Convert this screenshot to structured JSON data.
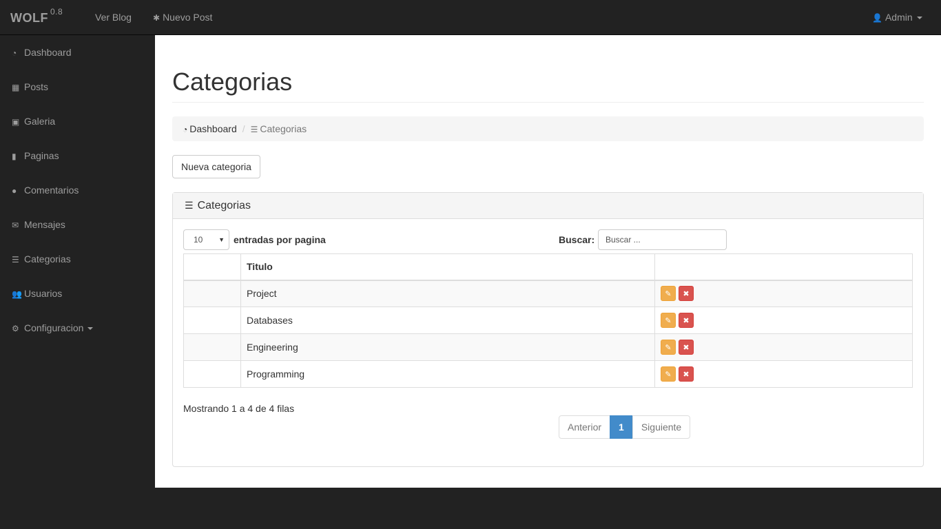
{
  "navbar": {
    "brand": "WOLF",
    "version": "0.8",
    "links": [
      {
        "label": "Ver Blog",
        "icon": ""
      },
      {
        "label": "Nuevo Post",
        "icon": "asterisk-icon"
      }
    ],
    "user": {
      "label": "Admin",
      "icon": "user-icon"
    }
  },
  "sidebar": {
    "items": [
      {
        "label": "Dashboard",
        "icon": "dashboard-icon"
      },
      {
        "label": "Posts",
        "icon": "grid-icon"
      },
      {
        "label": "Galeria",
        "icon": "image-icon"
      },
      {
        "label": "Paginas",
        "icon": "file-icon"
      },
      {
        "label": "Comentarios",
        "icon": "comments-icon"
      },
      {
        "label": "Mensajes",
        "icon": "envelope-icon"
      },
      {
        "label": "Categorias",
        "icon": "list-icon"
      },
      {
        "label": "Usuarios",
        "icon": "users-icon"
      },
      {
        "label": "Configuracion",
        "icon": "cogs-icon"
      }
    ]
  },
  "page": {
    "title": "Categorias",
    "breadcrumb": [
      {
        "label": "Dashboard",
        "icon": "dashboard-icon"
      },
      {
        "label": "Categorias",
        "icon": "list-icon"
      }
    ],
    "new_button": "Nueva categoria"
  },
  "panel": {
    "title": "Categorias",
    "icon": "list-icon",
    "length_value": "10",
    "length_label": "entradas por pagina",
    "search_label": "Buscar:",
    "search_placeholder": "Buscar ...",
    "table": {
      "columns": [
        "",
        "Titulo",
        ""
      ],
      "rows": [
        {
          "title": "Project"
        },
        {
          "title": "Databases"
        },
        {
          "title": "Engineering"
        },
        {
          "title": "Programming"
        }
      ]
    },
    "info": "Mostrando 1 a 4 de 4 filas",
    "pagination": {
      "prev": "Anterior",
      "current": "1",
      "next": "Siguiente"
    }
  },
  "colors": {
    "navbar_bg": "#222222",
    "accent": "#428bca",
    "edit": "#f0ad4e",
    "delete": "#d9534f"
  }
}
